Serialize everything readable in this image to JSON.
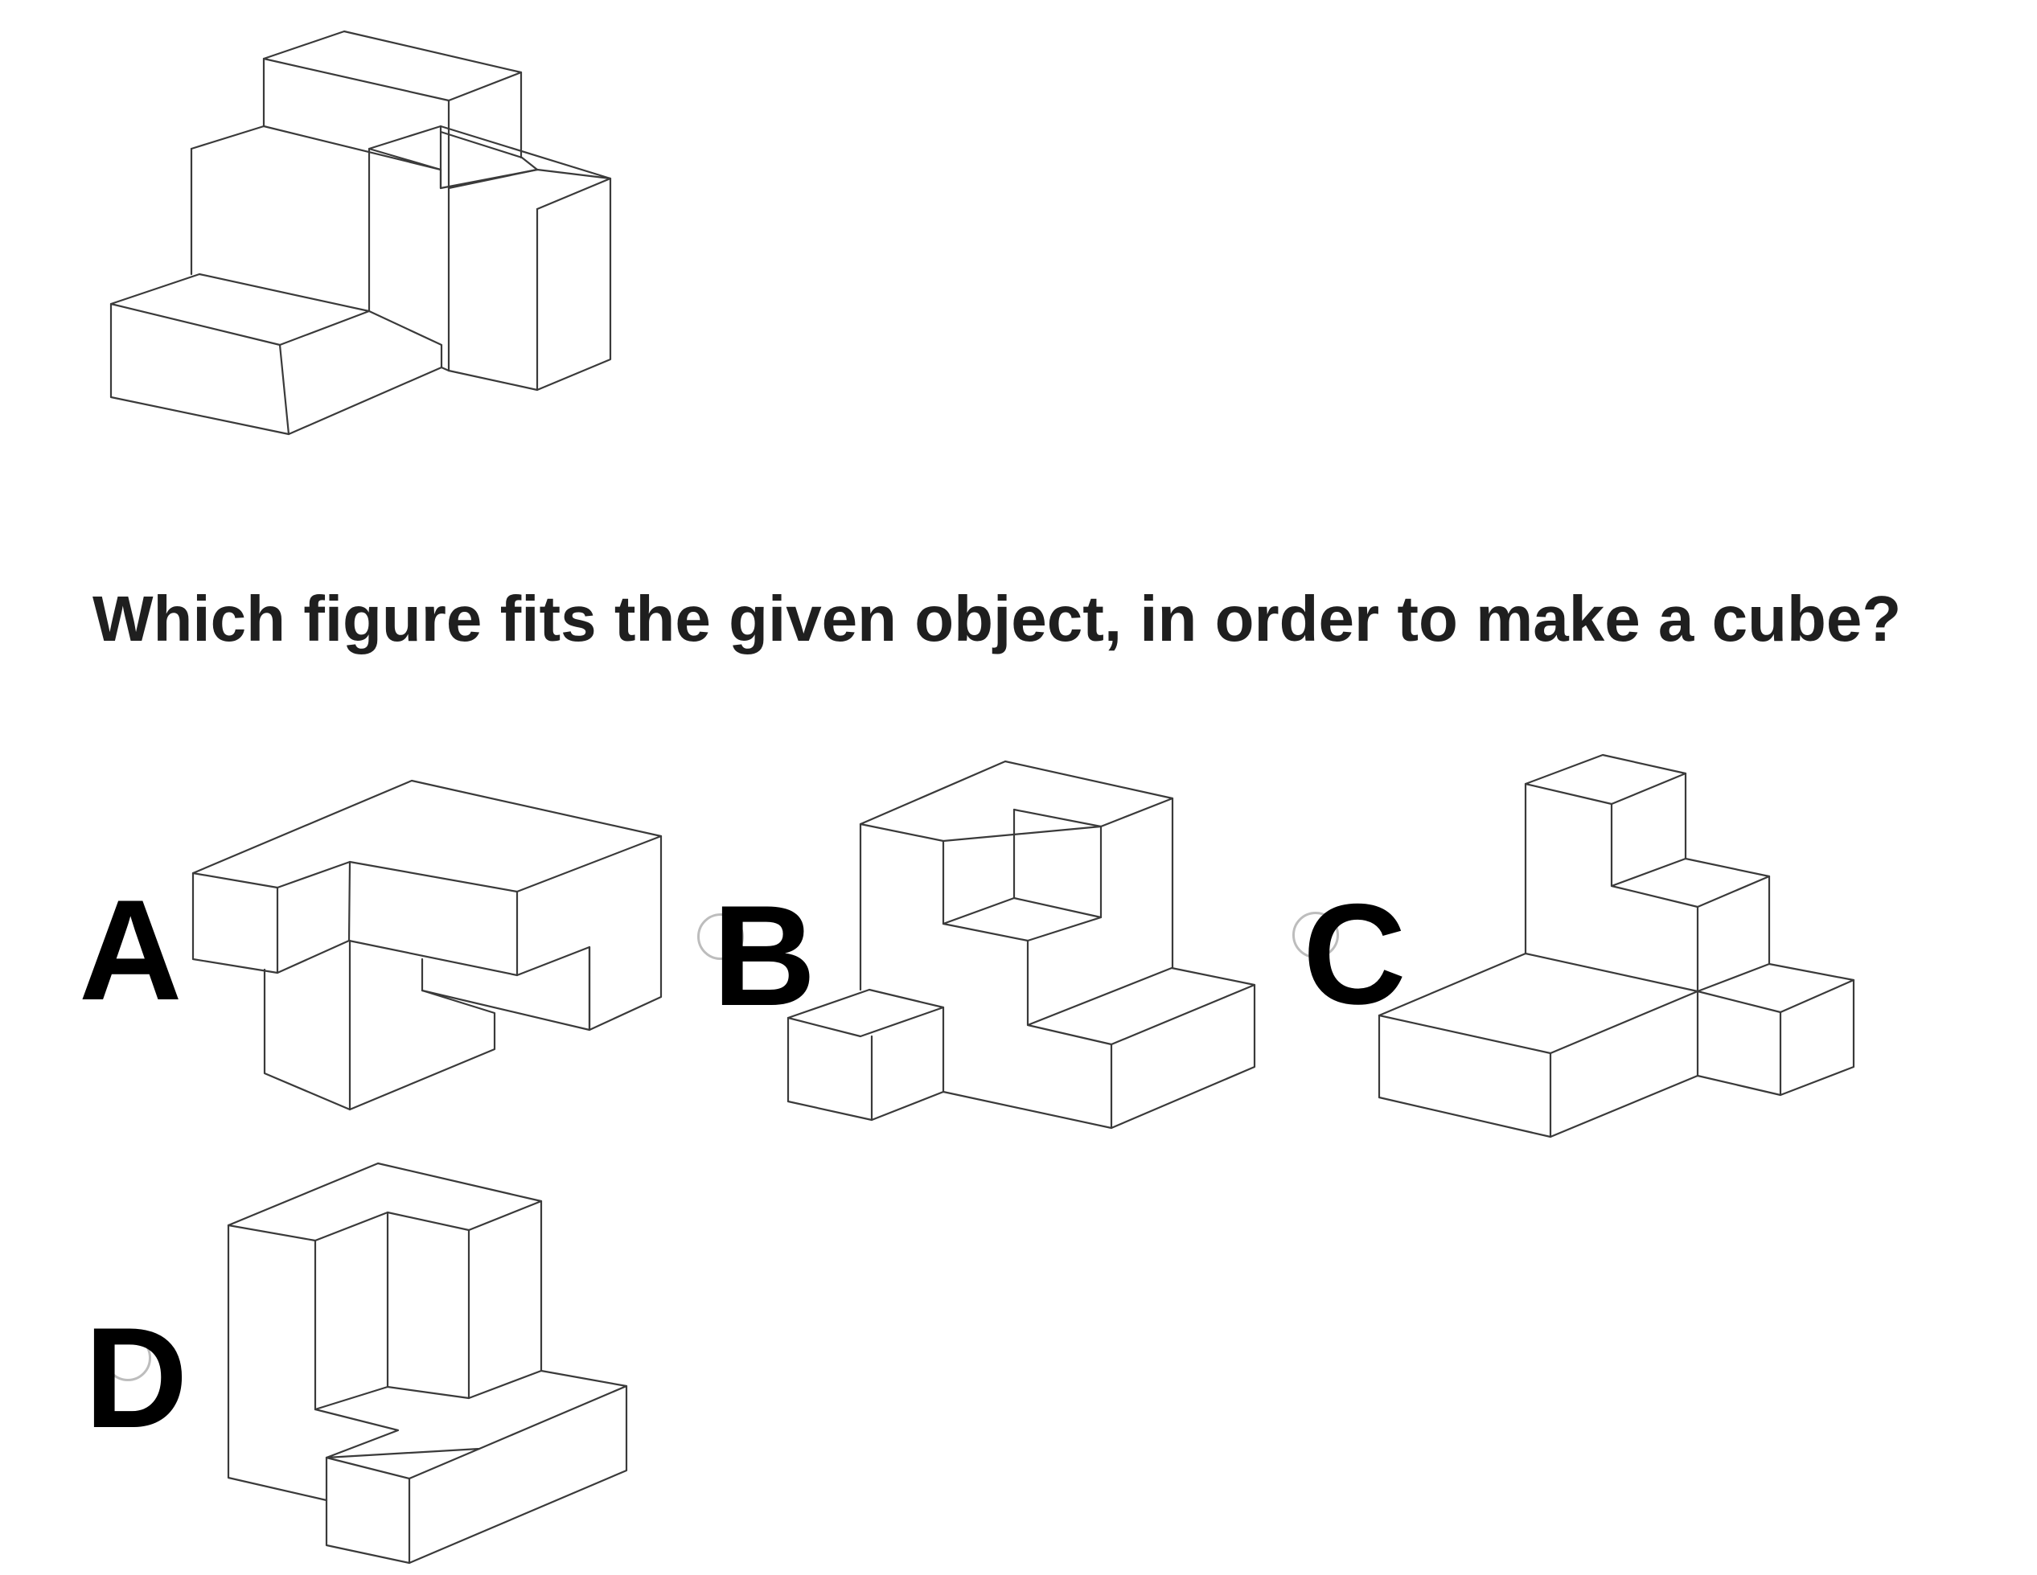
{
  "question": "Which figure fits the given object, in order to make a cube?",
  "options": [
    {
      "label": "A"
    },
    {
      "label": "B"
    },
    {
      "label": "C"
    },
    {
      "label": "D"
    }
  ]
}
